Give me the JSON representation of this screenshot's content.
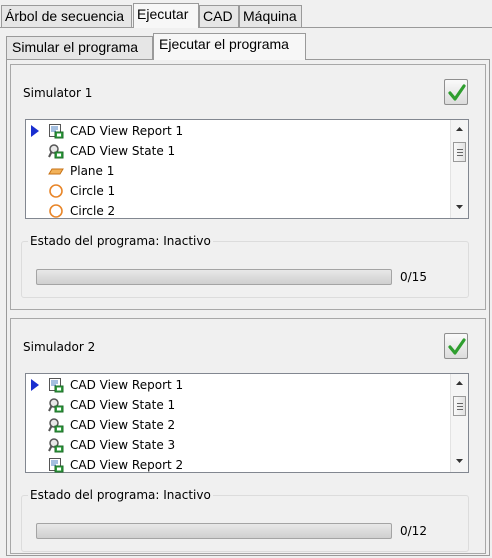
{
  "top_tabs": [
    {
      "label": "Árbol de secuencia",
      "active": false
    },
    {
      "label": "Ejecutar",
      "active": true
    },
    {
      "label": "CAD",
      "active": false
    },
    {
      "label": "Máquina",
      "active": false
    }
  ],
  "sub_tabs": [
    {
      "label": "Simular el programa",
      "active": false
    },
    {
      "label": "Ejecutar el programa",
      "active": true
    }
  ],
  "simulators": [
    {
      "title": "Simulator 1",
      "items": [
        {
          "label": "CAD View Report 1",
          "icon": "report-icon",
          "current": true
        },
        {
          "label": "CAD View State 1",
          "icon": "view-state-icon",
          "current": false
        },
        {
          "label": "Plane 1",
          "icon": "plane-icon",
          "current": false
        },
        {
          "label": "Circle 1",
          "icon": "circle-icon",
          "current": false
        },
        {
          "label": "Circle 2",
          "icon": "circle-icon",
          "current": false
        }
      ],
      "status_label": "Estado del programa: Inactivo",
      "progress": {
        "value": 0,
        "total": 15,
        "text": "0/15"
      }
    },
    {
      "title": "Simulador 2",
      "items": [
        {
          "label": "CAD View Report 1",
          "icon": "report-icon",
          "current": true
        },
        {
          "label": "CAD View State 1",
          "icon": "view-state-icon",
          "current": false
        },
        {
          "label": "CAD View State 2",
          "icon": "view-state-icon",
          "current": false
        },
        {
          "label": "CAD View State 3",
          "icon": "view-state-icon",
          "current": false
        },
        {
          "label": "CAD View Report 2",
          "icon": "report-icon",
          "current": false
        }
      ],
      "status_label": "Estado del programa: Inactivo",
      "progress": {
        "value": 0,
        "total": 12,
        "text": "0/12"
      }
    }
  ],
  "colors": {
    "check": "#2f9e2f",
    "arrow": "#1a2fd0",
    "plane": "#e6962e",
    "circle": "#e8862a"
  }
}
